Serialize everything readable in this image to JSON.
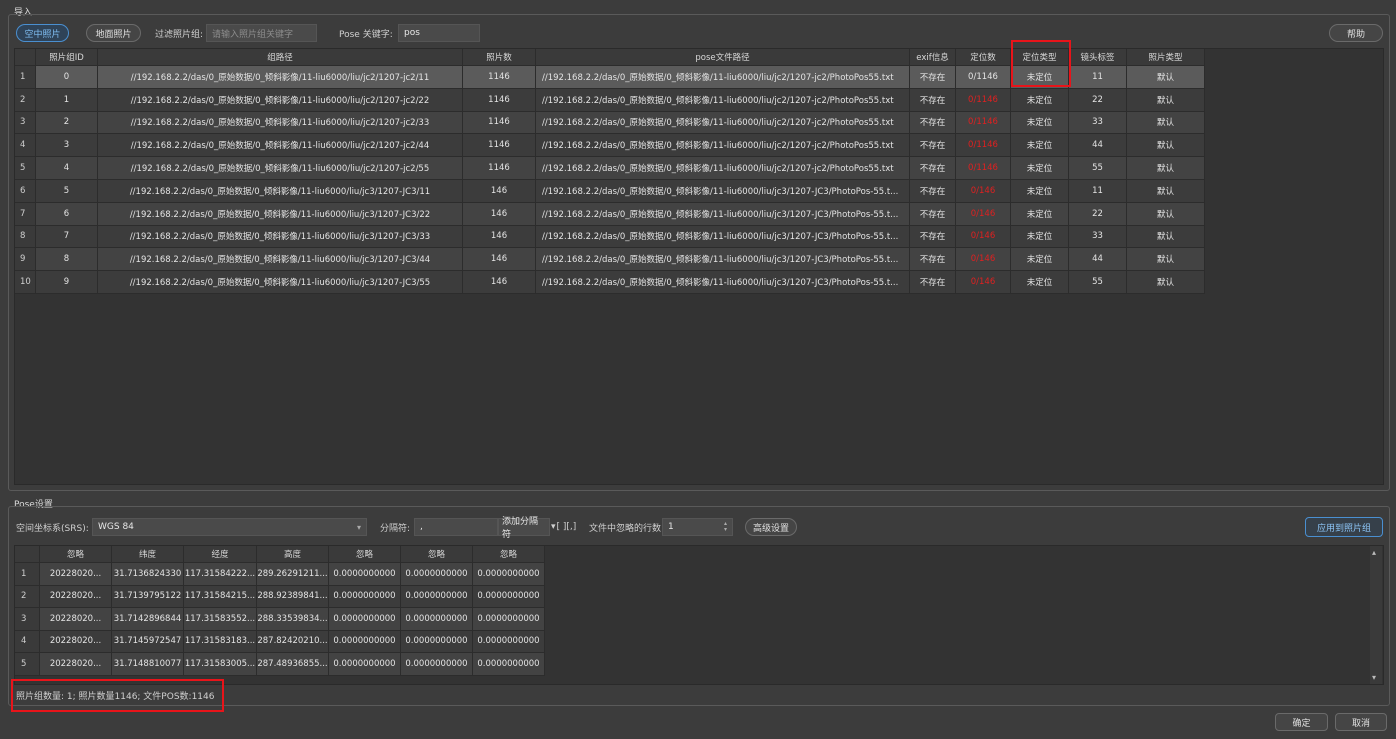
{
  "import_section": {
    "title": "导入"
  },
  "toolbar": {
    "aerial_tab": "空中照片",
    "ground_tab": "地面照片",
    "filter_label": "过滤照片组:",
    "filter_placeholder": "请输入照片组关键字",
    "pose_key_label": "Pose 关键字:",
    "pose_key_value": "pos",
    "help_label": "帮助"
  },
  "photo_table": {
    "columns": [
      "照片组ID",
      "组路径",
      "照片数",
      "pose文件路径",
      "exif信息",
      "定位数",
      "定位类型",
      "镜头标签",
      "照片类型"
    ],
    "rows": [
      {
        "num": "1",
        "id": "0",
        "path": "//192.168.2.2/das/0_原始数据/0_倾斜影像/11-liu6000/liu/jc2/1207-jc2/11",
        "count": "1146",
        "pose": "//192.168.2.2/das/0_原始数据/0_倾斜影像/11-liu6000/liu/jc2/1207-jc2/PhotoPos55.txt",
        "exif": "不存在",
        "located": "0/1146",
        "loc_type": "未定位",
        "lens": "11",
        "ptype": "默认"
      },
      {
        "num": "2",
        "id": "1",
        "path": "//192.168.2.2/das/0_原始数据/0_倾斜影像/11-liu6000/liu/jc2/1207-jc2/22",
        "count": "1146",
        "pose": "//192.168.2.2/das/0_原始数据/0_倾斜影像/11-liu6000/liu/jc2/1207-jc2/PhotoPos55.txt",
        "exif": "不存在",
        "located": "0/1146",
        "loc_type": "未定位",
        "lens": "22",
        "ptype": "默认"
      },
      {
        "num": "3",
        "id": "2",
        "path": "//192.168.2.2/das/0_原始数据/0_倾斜影像/11-liu6000/liu/jc2/1207-jc2/33",
        "count": "1146",
        "pose": "//192.168.2.2/das/0_原始数据/0_倾斜影像/11-liu6000/liu/jc2/1207-jc2/PhotoPos55.txt",
        "exif": "不存在",
        "located": "0/1146",
        "loc_type": "未定位",
        "lens": "33",
        "ptype": "默认"
      },
      {
        "num": "4",
        "id": "3",
        "path": "//192.168.2.2/das/0_原始数据/0_倾斜影像/11-liu6000/liu/jc2/1207-jc2/44",
        "count": "1146",
        "pose": "//192.168.2.2/das/0_原始数据/0_倾斜影像/11-liu6000/liu/jc2/1207-jc2/PhotoPos55.txt",
        "exif": "不存在",
        "located": "0/1146",
        "loc_type": "未定位",
        "lens": "44",
        "ptype": "默认"
      },
      {
        "num": "5",
        "id": "4",
        "path": "//192.168.2.2/das/0_原始数据/0_倾斜影像/11-liu6000/liu/jc2/1207-jc2/55",
        "count": "1146",
        "pose": "//192.168.2.2/das/0_原始数据/0_倾斜影像/11-liu6000/liu/jc2/1207-jc2/PhotoPos55.txt",
        "exif": "不存在",
        "located": "0/1146",
        "loc_type": "未定位",
        "lens": "55",
        "ptype": "默认"
      },
      {
        "num": "6",
        "id": "5",
        "path": "//192.168.2.2/das/0_原始数据/0_倾斜影像/11-liu6000/liu/jc3/1207-JC3/11",
        "count": "146",
        "pose": "//192.168.2.2/das/0_原始数据/0_倾斜影像/11-liu6000/liu/jc3/1207-JC3/PhotoPos-55.t...",
        "exif": "不存在",
        "located": "0/146",
        "loc_type": "未定位",
        "lens": "11",
        "ptype": "默认"
      },
      {
        "num": "7",
        "id": "6",
        "path": "//192.168.2.2/das/0_原始数据/0_倾斜影像/11-liu6000/liu/jc3/1207-JC3/22",
        "count": "146",
        "pose": "//192.168.2.2/das/0_原始数据/0_倾斜影像/11-liu6000/liu/jc3/1207-JC3/PhotoPos-55.t...",
        "exif": "不存在",
        "located": "0/146",
        "loc_type": "未定位",
        "lens": "22",
        "ptype": "默认"
      },
      {
        "num": "8",
        "id": "7",
        "path": "//192.168.2.2/das/0_原始数据/0_倾斜影像/11-liu6000/liu/jc3/1207-JC3/33",
        "count": "146",
        "pose": "//192.168.2.2/das/0_原始数据/0_倾斜影像/11-liu6000/liu/jc3/1207-JC3/PhotoPos-55.t...",
        "exif": "不存在",
        "located": "0/146",
        "loc_type": "未定位",
        "lens": "33",
        "ptype": "默认"
      },
      {
        "num": "9",
        "id": "8",
        "path": "//192.168.2.2/das/0_原始数据/0_倾斜影像/11-liu6000/liu/jc3/1207-JC3/44",
        "count": "146",
        "pose": "//192.168.2.2/das/0_原始数据/0_倾斜影像/11-liu6000/liu/jc3/1207-JC3/PhotoPos-55.t...",
        "exif": "不存在",
        "located": "0/146",
        "loc_type": "未定位",
        "lens": "44",
        "ptype": "默认"
      },
      {
        "num": "10",
        "id": "9",
        "path": "//192.168.2.2/das/0_原始数据/0_倾斜影像/11-liu6000/liu/jc3/1207-JC3/55",
        "count": "146",
        "pose": "//192.168.2.2/das/0_原始数据/0_倾斜影像/11-liu6000/liu/jc3/1207-JC3/PhotoPos-55.t...",
        "exif": "不存在",
        "located": "0/146",
        "loc_type": "未定位",
        "lens": "55",
        "ptype": "默认"
      }
    ]
  },
  "pose_section": {
    "title": "Pose设置",
    "srs_label": "空间坐标系(SRS):",
    "srs_value": "WGS 84",
    "separator_label": "分隔符:",
    "separator_value": ",",
    "add_separator_label": "添加分隔符",
    "separator_hint": "[ ][,]",
    "skip_lines_label": "文件中忽略的行数:",
    "skip_lines_value": "1",
    "advanced_label": "高级设置",
    "apply_label": "应用到照片组"
  },
  "pose_table": {
    "columns": [
      "忽略",
      "纬度",
      "经度",
      "高度",
      "忽略",
      "忽略",
      "忽略"
    ],
    "rows": [
      {
        "num": "1",
        "c": [
          "20228020...",
          "31.7136824330",
          "117.31584222...",
          "289.26291211...",
          "0.0000000000",
          "0.0000000000",
          "0.0000000000"
        ]
      },
      {
        "num": "2",
        "c": [
          "20228020...",
          "31.7139795122",
          "117.31584215...",
          "288.92389841...",
          "0.0000000000",
          "0.0000000000",
          "0.0000000000"
        ]
      },
      {
        "num": "3",
        "c": [
          "20228020...",
          "31.7142896844",
          "117.31583552...",
          "288.33539834...",
          "0.0000000000",
          "0.0000000000",
          "0.0000000000"
        ]
      },
      {
        "num": "4",
        "c": [
          "20228020...",
          "31.7145972547",
          "117.31583183...",
          "287.82420210...",
          "0.0000000000",
          "0.0000000000",
          "0.0000000000"
        ]
      },
      {
        "num": "5",
        "c": [
          "20228020...",
          "31.7148810077",
          "117.31583005...",
          "287.48936855...",
          "0.0000000000",
          "0.0000000000",
          "0.0000000000"
        ]
      }
    ]
  },
  "status": {
    "summary": "照片组数量: 1; 照片数量1146; 文件POS数:1146"
  },
  "footer": {
    "ok_label": "确定",
    "cancel_label": "取消"
  },
  "colors": {
    "highlight_red": "#e8141a",
    "accent_blue": "#4a8fd0",
    "located_red": "#e02020"
  }
}
